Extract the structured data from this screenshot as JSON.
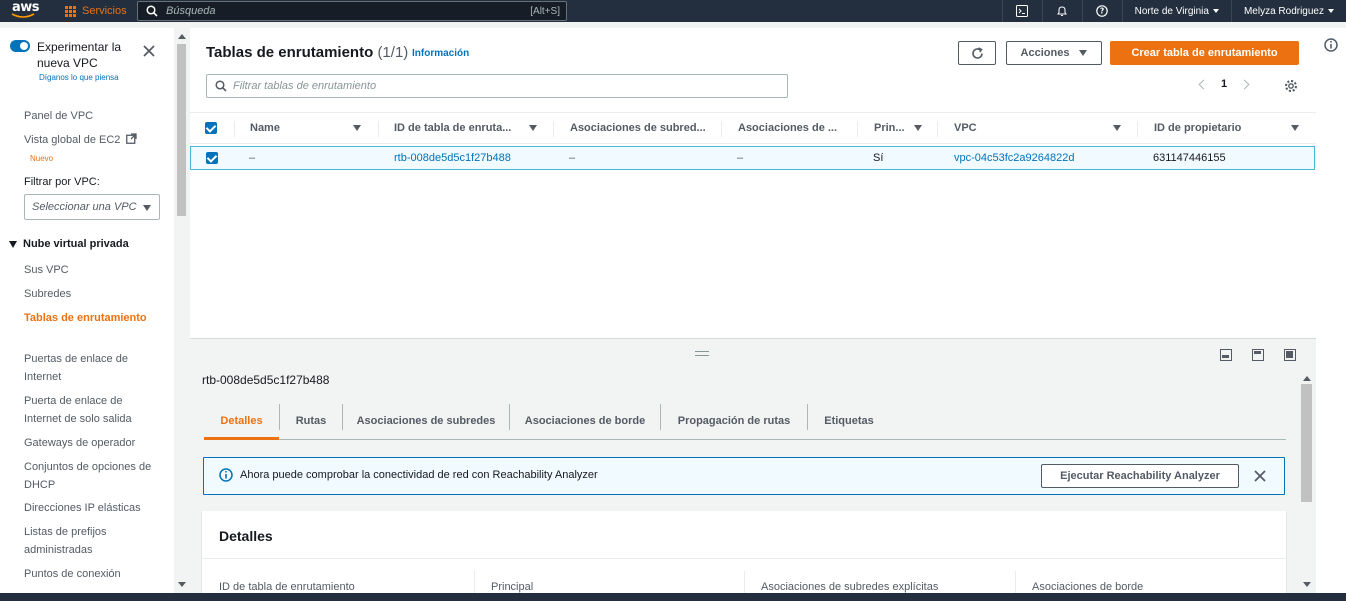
{
  "topnav": {
    "logo_text": "aws",
    "services_label": "Servicios",
    "search_placeholder": "Búsqueda",
    "search_shortcut": "[Alt+S]",
    "region": "Norte de Virginia",
    "user": "Melyza Rodriguez"
  },
  "sidebar": {
    "toggle_label": "Experimentar la nueva VPC",
    "feedback_link": "Díganos lo que piensa",
    "vpc_dashboard": "Panel de VPC",
    "ec2_global": "Vista global de EC2",
    "new_badge": "Nuevo",
    "filter_label": "Filtrar por VPC:",
    "filter_placeholder": "Seleccionar una VPC",
    "section_title": "Nube virtual privada",
    "items": [
      "Sus VPC",
      "Subredes",
      "Tablas de enrutamiento",
      "Puertas de enlace de Internet",
      "Puerta de enlace de Internet de solo salida",
      "Gateways de operador",
      "Conjuntos de opciones de DHCP",
      "Direcciones IP elásticas",
      "Listas de prefijos administradas",
      "Puntos de conexión"
    ]
  },
  "main": {
    "title": "Tablas de enrutamiento",
    "count": "(1/1)",
    "info_link": "Información",
    "actions_label": "Acciones",
    "create_label": "Crear tabla de enrutamiento",
    "filter_placeholder": "Filtrar tablas de enrutamiento",
    "page": "1",
    "columns": [
      "Name",
      "ID de tabla de enruta...",
      "Asociaciones de subred...",
      "Asociaciones de ...",
      "Prin...",
      "VPC",
      "ID de propietario"
    ],
    "row": {
      "name": "–",
      "route_table_id": "rtb-008de5d5c1f27b488",
      "subnet_assoc": "–",
      "edge_assoc": "–",
      "main": "Sí",
      "vpc": "vpc-04c53fc2a9264822d",
      "owner": "631147446155"
    }
  },
  "detail": {
    "id": "rtb-008de5d5c1f27b488",
    "tabs": [
      "Detalles",
      "Rutas",
      "Asociaciones de subredes",
      "Asociaciones de borde",
      "Propagación de rutas",
      "Etiquetas"
    ],
    "alert_text": "Ahora puede comprobar la conectividad de red con Reachability Analyzer",
    "alert_button": "Ejecutar Reachability Analyzer",
    "card_title": "Detalles",
    "fields": [
      "ID de tabla de enrutamiento",
      "Principal",
      "Asociaciones de subredes explícitas",
      "Asociaciones de borde"
    ]
  },
  "colors": {
    "accent": "#ec7211",
    "link": "#0073bb",
    "nav_bg": "#232f3e"
  }
}
